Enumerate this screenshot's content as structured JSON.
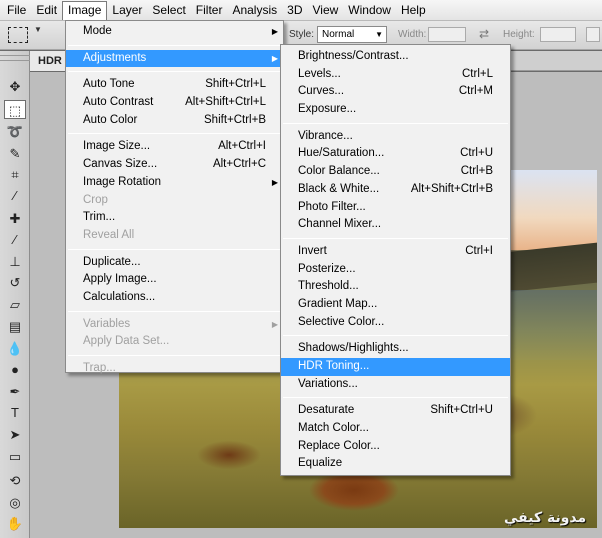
{
  "menubar": [
    "File",
    "Edit",
    "Image",
    "Layer",
    "Select",
    "Filter",
    "Analysis",
    "3D",
    "View",
    "Window",
    "Help"
  ],
  "options": {
    "style_label": "Style:",
    "style_value": "Normal",
    "width_label": "Width:",
    "height_label": "Height:"
  },
  "tab": {
    "label": "HDR"
  },
  "image_menu": {
    "mode": "Mode",
    "adjustments": "Adjustments",
    "auto_tone": "Auto Tone",
    "auto_tone_sc": "Shift+Ctrl+L",
    "auto_contrast": "Auto Contrast",
    "auto_contrast_sc": "Alt+Shift+Ctrl+L",
    "auto_color": "Auto Color",
    "auto_color_sc": "Shift+Ctrl+B",
    "image_size": "Image Size...",
    "image_size_sc": "Alt+Ctrl+I",
    "canvas_size": "Canvas Size...",
    "canvas_size_sc": "Alt+Ctrl+C",
    "image_rotation": "Image Rotation",
    "crop": "Crop",
    "trim": "Trim...",
    "reveal_all": "Reveal All",
    "duplicate": "Duplicate...",
    "apply_image": "Apply Image...",
    "calculations": "Calculations...",
    "variables": "Variables",
    "apply_data_set": "Apply Data Set...",
    "trap": "Trap..."
  },
  "adj_menu": {
    "brightness": "Brightness/Contrast...",
    "levels": "Levels...",
    "levels_sc": "Ctrl+L",
    "curves": "Curves...",
    "curves_sc": "Ctrl+M",
    "exposure": "Exposure...",
    "vibrance": "Vibrance...",
    "hue_sat": "Hue/Saturation...",
    "hue_sat_sc": "Ctrl+U",
    "color_balance": "Color Balance...",
    "color_balance_sc": "Ctrl+B",
    "black_white": "Black & White...",
    "black_white_sc": "Alt+Shift+Ctrl+B",
    "photo_filter": "Photo Filter...",
    "channel_mixer": "Channel Mixer...",
    "invert": "Invert",
    "invert_sc": "Ctrl+I",
    "posterize": "Posterize...",
    "threshold": "Threshold...",
    "gradient_map": "Gradient Map...",
    "selective_color": "Selective Color...",
    "shadows_highlights": "Shadows/Highlights...",
    "hdr_toning": "HDR Toning...",
    "variations": "Variations...",
    "desaturate": "Desaturate",
    "desaturate_sc": "Shift+Ctrl+U",
    "match_color": "Match Color...",
    "replace_color": "Replace Color...",
    "equalize": "Equalize"
  },
  "watermark": "مدونة كيفي",
  "colors": {
    "highlight": "#3399ff",
    "menu_bg": "#f1f1f1"
  }
}
